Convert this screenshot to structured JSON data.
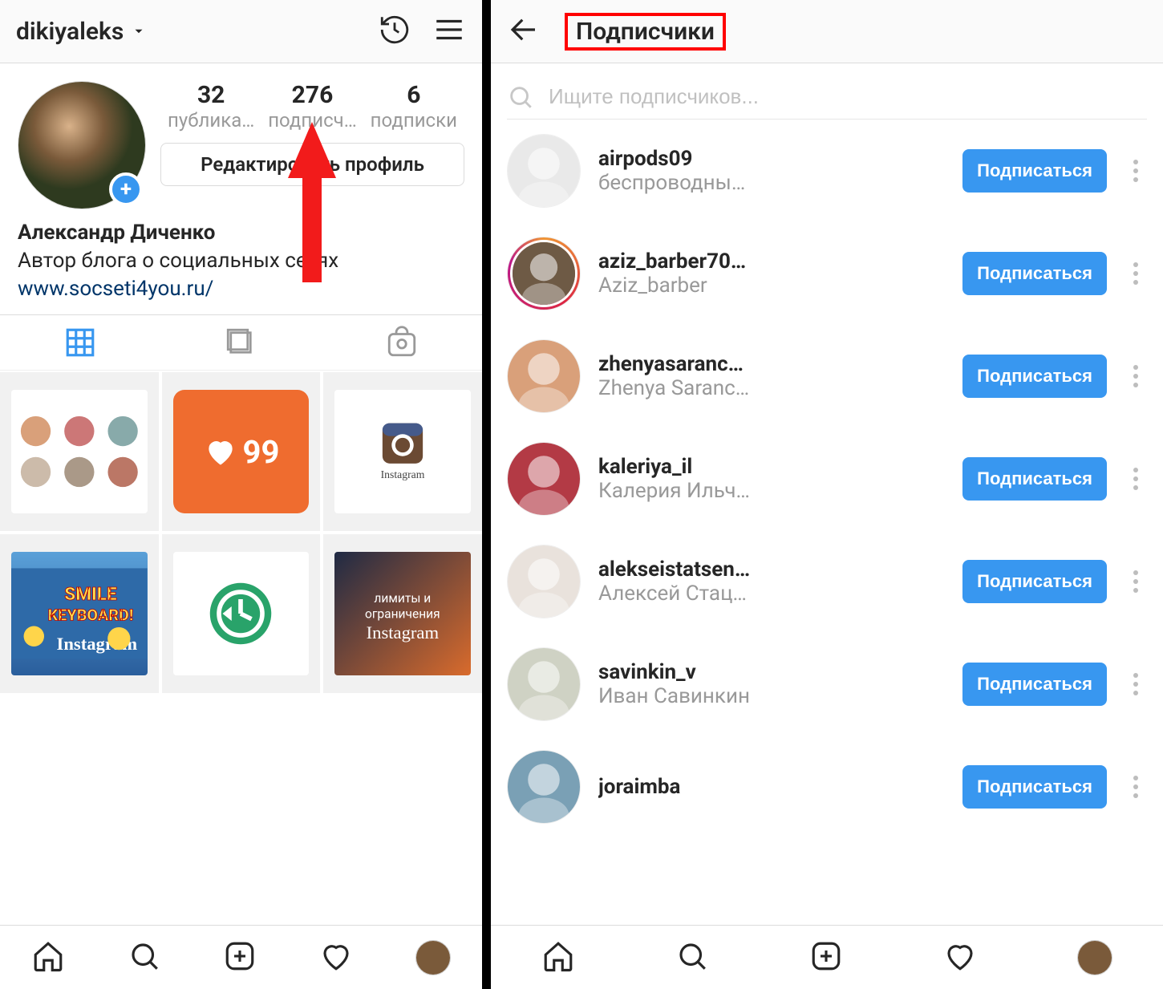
{
  "left": {
    "username": "dikiyaleks",
    "stats": {
      "posts": {
        "count": "32",
        "label": "публика…"
      },
      "followers": {
        "count": "276",
        "label": "подписч…"
      },
      "following": {
        "count": "6",
        "label": "подписки"
      }
    },
    "edit_profile_label": "Редактировать профиль",
    "bio": {
      "name": "Александр Диченко",
      "desc": "Автор блога о социальных сетях",
      "link": "www.socseti4you.ru/"
    },
    "grid_thumbs": [
      {
        "label": "people-collage"
      },
      {
        "label": "orange-heart-99",
        "badge": "99"
      },
      {
        "label": "instagram-logo"
      },
      {
        "label": "smile-keyboard-instagram"
      },
      {
        "label": "green-clock-restore"
      },
      {
        "label": "limits-instagram-sunset"
      }
    ]
  },
  "right": {
    "title": "Подписчики",
    "search_placeholder": "Ищите подписчиков...",
    "follow_label": "Подписаться",
    "followers": [
      {
        "username": "airpods09",
        "subtitle": "беспроводны…",
        "story": false,
        "tone": "#e9e9e9"
      },
      {
        "username": "aziz_barber70…",
        "subtitle": "Aziz_barber",
        "story": true,
        "tone": "#6e5a45"
      },
      {
        "username": "zhenyasaranc…",
        "subtitle": "Zhenya Saranc…",
        "story": false,
        "tone": "#d9a07a"
      },
      {
        "username": "kaleriya_il",
        "subtitle": "Калерия Ильч…",
        "story": false,
        "tone": "#b33a45"
      },
      {
        "username": "alekseistatsen…",
        "subtitle": "Алексей Стац…",
        "story": false,
        "tone": "#e9e2dc"
      },
      {
        "username": "savinkin_v",
        "subtitle": "Иван Савинкин",
        "story": false,
        "tone": "#cfd2c4"
      },
      {
        "username": "joraimba",
        "subtitle": "",
        "story": false,
        "tone": "#7aa0b5"
      }
    ]
  }
}
